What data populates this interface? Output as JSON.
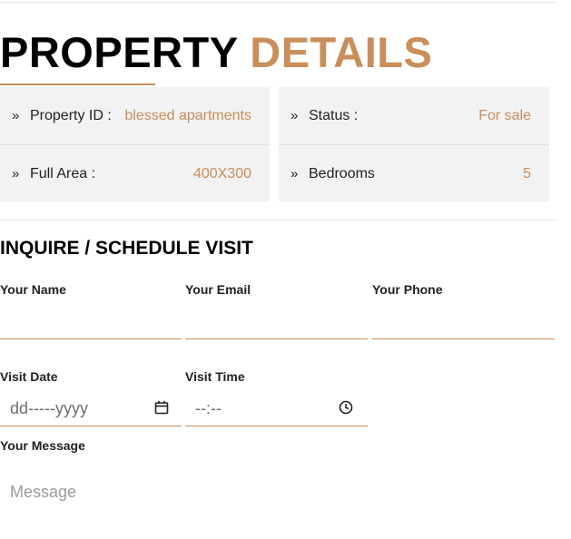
{
  "heading": {
    "part1": "PROPERTY",
    "part2": "DETAILS"
  },
  "details": {
    "property_id": {
      "label": "Property ID :",
      "value": "blessed apartments"
    },
    "full_area": {
      "label": "Full Area :",
      "value": "400X300"
    },
    "status": {
      "label": "Status :",
      "value": "For sale"
    },
    "bedrooms": {
      "label": "Bedrooms",
      "value": "5"
    }
  },
  "form": {
    "title": "INQUIRE / SCHEDULE VISIT",
    "name_label": "Your Name",
    "email_label": "Your Email",
    "phone_label": "Your Phone",
    "date_label": "Visit Date",
    "date_value": "dd-----yyyy",
    "time_label": "Visit Time",
    "time_value": "--:--",
    "message_label": "Your Message",
    "message_placeholder": "Message"
  },
  "colors": {
    "accent": "#c98e5a",
    "card_bg": "#f2f2f2"
  },
  "icons": {
    "row_marker": "chevron-double-right-icon",
    "date": "calendar-icon",
    "time": "clock-icon"
  }
}
